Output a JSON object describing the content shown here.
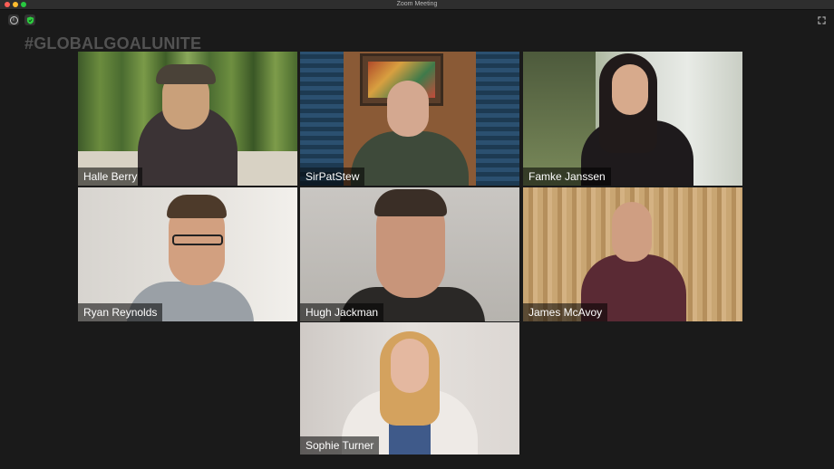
{
  "window": {
    "title": "Zoom Meeting"
  },
  "overlay": {
    "hashtag": "#GLOBALGOALUNITE"
  },
  "icons": {
    "info": "info-icon",
    "security": "shield-icon",
    "fullscreen": "fullscreen-icon"
  },
  "participants": [
    {
      "name": "Halle Berry"
    },
    {
      "name": "SirPatStew"
    },
    {
      "name": "Famke Janssen"
    },
    {
      "name": "Ryan Reynolds"
    },
    {
      "name": "Hugh Jackman"
    },
    {
      "name": "James McAvoy"
    },
    {
      "name": "Sophie Turner"
    }
  ],
  "colors": {
    "background": "#1a1a1a",
    "shield": "#2ecc40"
  }
}
